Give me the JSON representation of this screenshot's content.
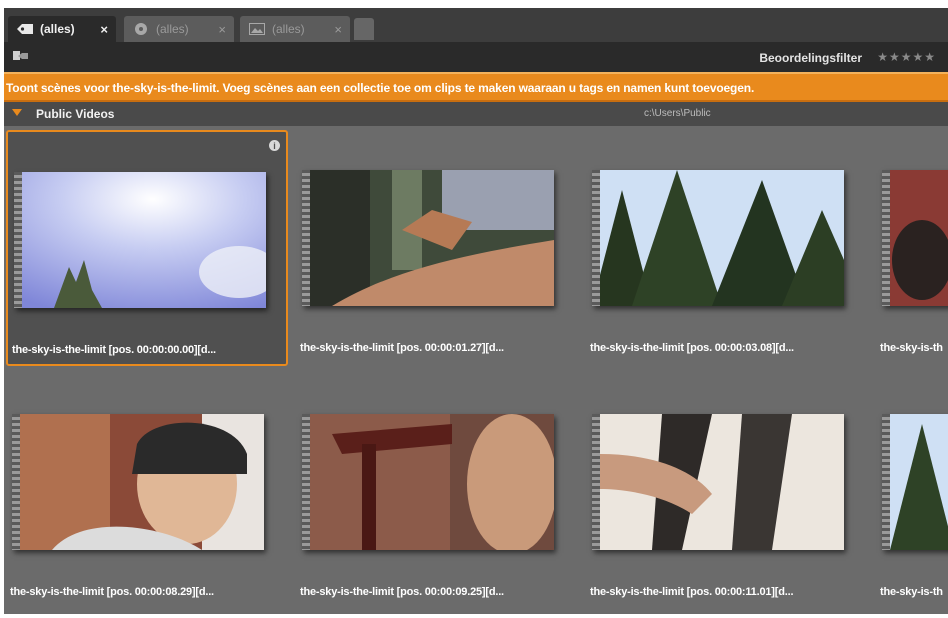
{
  "tabs": [
    {
      "label": "(alles)",
      "close": "×",
      "icon": "tag-icon",
      "active": true
    },
    {
      "label": "(alles)",
      "close": "×",
      "icon": "disc-icon",
      "active": false
    },
    {
      "label": "(alles)",
      "close": "×",
      "icon": "image-icon",
      "active": false
    }
  ],
  "toolbar": {
    "filter_label": "Beoordelingsfilter",
    "stars": "★★★★★"
  },
  "info_bar": {
    "message": "Toont scènes voor the-sky-is-the-limit. Voeg scènes aan een collectie toe om clips te maken waaraan u tags en namen kunt toevoegen."
  },
  "section": {
    "title": "Public Videos",
    "path": "c:\\Users\\Public"
  },
  "scenes": [
    {
      "caption": "the-sky-is-the-limit [pos. 00:00:00.00][d...",
      "selected": true
    },
    {
      "caption": "the-sky-is-the-limit [pos. 00:00:01.27][d..."
    },
    {
      "caption": "the-sky-is-the-limit [pos. 00:00:03.08][d..."
    },
    {
      "caption": "the-sky-is-th"
    },
    {
      "caption": "the-sky-is-the-limit [pos. 00:00:08.29][d..."
    },
    {
      "caption": "the-sky-is-the-limit [pos. 00:00:09.25][d..."
    },
    {
      "caption": "the-sky-is-the-limit [pos. 00:00:11.01][d..."
    },
    {
      "caption": "the-sky-is-th"
    }
  ],
  "colors": {
    "accent": "#e98a1d",
    "panel": "#6b6b6b",
    "toolbar": "#2a2a2a"
  }
}
